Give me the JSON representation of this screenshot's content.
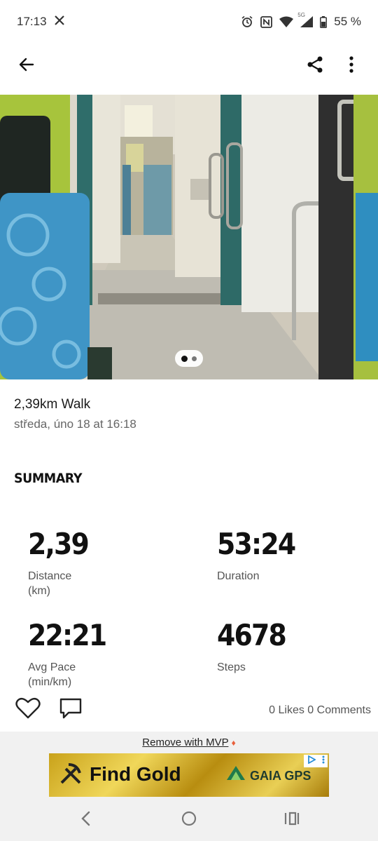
{
  "status_bar": {
    "time": "17:13",
    "battery": "55 %",
    "network": "5G",
    "icons": [
      "x-logo-icon",
      "alarm-icon",
      "nfc-icon",
      "wifi-icon",
      "signal-icon",
      "battery-icon"
    ]
  },
  "app_bar": {
    "back_icon": "arrow-left-icon",
    "share_icon": "share-icon",
    "more_icon": "more-vertical-icon"
  },
  "photo": {
    "pager": {
      "count": 2,
      "active_index": 0
    }
  },
  "activity": {
    "title": "2,39km Walk",
    "date": "středa, úno 18 at 16:18"
  },
  "summary": {
    "heading": "SUMMARY",
    "stats": [
      {
        "value": "2,39",
        "label": "Distance",
        "unit": "(km)"
      },
      {
        "value": "53:24",
        "label": "Duration",
        "unit": ""
      },
      {
        "value": "22:21",
        "label": "Avg Pace",
        "unit": "(min/km)"
      },
      {
        "value": "4678",
        "label": "Steps",
        "unit": ""
      }
    ]
  },
  "social": {
    "counts": "0 Likes 0 Comments",
    "like_icon": "heart-icon",
    "comment_icon": "comment-icon"
  },
  "ad": {
    "remove_text": "Remove with MVP",
    "title": "Find Gold",
    "brand": "GAIA GPS",
    "colors": {
      "gold": "#d9b73a",
      "text": "#111111"
    }
  },
  "nav_bar": {
    "icons": [
      "back-nav-icon",
      "home-nav-icon",
      "recents-nav-icon"
    ]
  }
}
